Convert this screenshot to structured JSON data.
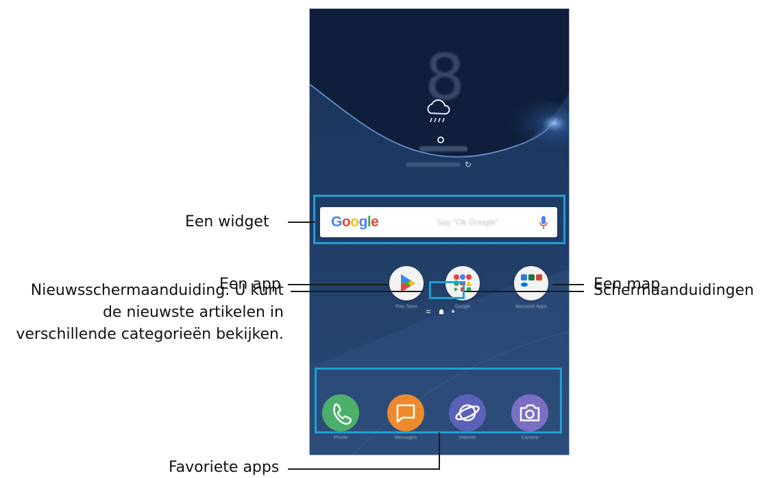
{
  "labels": {
    "widget": "Een widget",
    "app": "Een app",
    "map": "Een map",
    "news_line1": "Nieuwsschermaanduiding. U kunt",
    "news_line2": "de nieuwste artikelen in",
    "news_line3": "verschillende categorieën bekijken.",
    "screen_indicators": "Schermaanduidingen",
    "favorite_apps": "Favoriete apps"
  },
  "widget": {
    "logo": "Google",
    "hint": "Say \"Ok Google\""
  },
  "apps": [
    {
      "name": "Play Store",
      "icon": "play-store-icon"
    },
    {
      "name": "Google",
      "icon": "google-apps-folder-icon"
    },
    {
      "name": "Microsoft Apps",
      "icon": "microsoft-apps-folder-icon"
    }
  ],
  "dock": [
    {
      "name": "Phone",
      "icon": "phone-icon",
      "color": "#4caf6a"
    },
    {
      "name": "Messages",
      "icon": "messages-icon",
      "color": "#ee8a2e"
    },
    {
      "name": "Internet",
      "icon": "internet-icon",
      "color": "#5b63b8"
    },
    {
      "name": "Camera",
      "icon": "camera-icon",
      "color": "#7b6fc4"
    }
  ],
  "colors": {
    "callout": "#1fa0d8",
    "google_blue": "#4285F4",
    "google_red": "#EA4335",
    "google_yellow": "#FBBC05",
    "google_green": "#34A853"
  }
}
